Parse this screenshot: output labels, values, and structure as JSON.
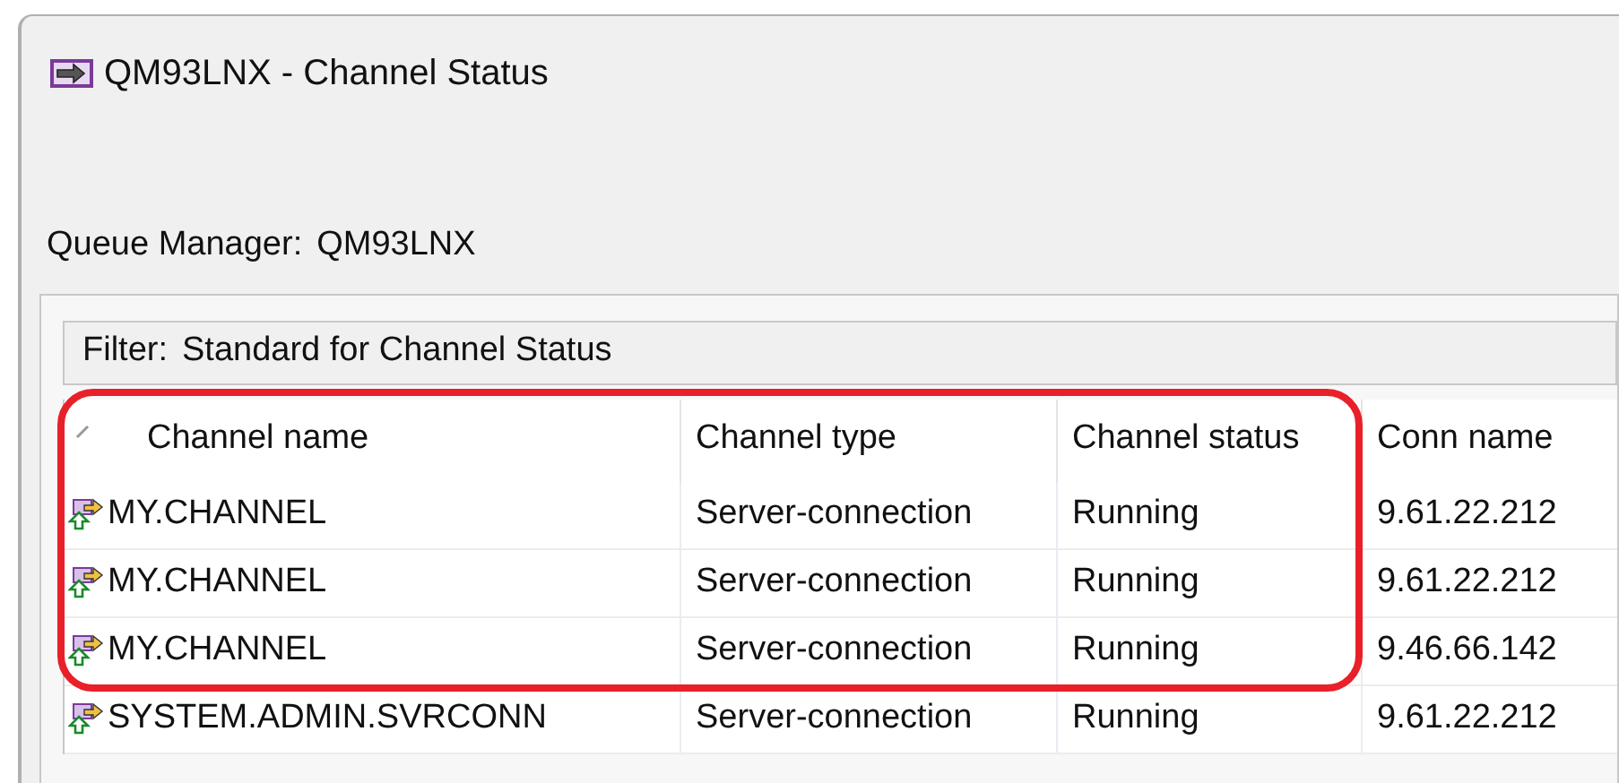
{
  "window": {
    "title": "QM93LNX - Channel Status"
  },
  "queue_manager": {
    "label": "Queue Manager:",
    "value": "QM93LNX"
  },
  "filter": {
    "label": "Filter:",
    "value": "Standard for Channel Status"
  },
  "table": {
    "columns": [
      {
        "label": "Channel name",
        "sorted": true
      },
      {
        "label": "Channel type",
        "sorted": false
      },
      {
        "label": "Channel status",
        "sorted": false
      },
      {
        "label": "Conn name",
        "sorted": false
      }
    ],
    "rows": [
      {
        "cells": [
          "MY.CHANNEL",
          "Server-connection",
          "Running",
          "9.61.22.212"
        ],
        "highlighted": true
      },
      {
        "cells": [
          "MY.CHANNEL",
          "Server-connection",
          "Running",
          "9.61.22.212"
        ],
        "highlighted": true
      },
      {
        "cells": [
          "MY.CHANNEL",
          "Server-connection",
          "Running",
          "9.46.66.142"
        ],
        "highlighted": true
      },
      {
        "cells": [
          "SYSTEM.ADMIN.SVRCONN",
          "Server-connection",
          "Running",
          "9.61.22.212"
        ],
        "highlighted": false
      }
    ]
  }
}
